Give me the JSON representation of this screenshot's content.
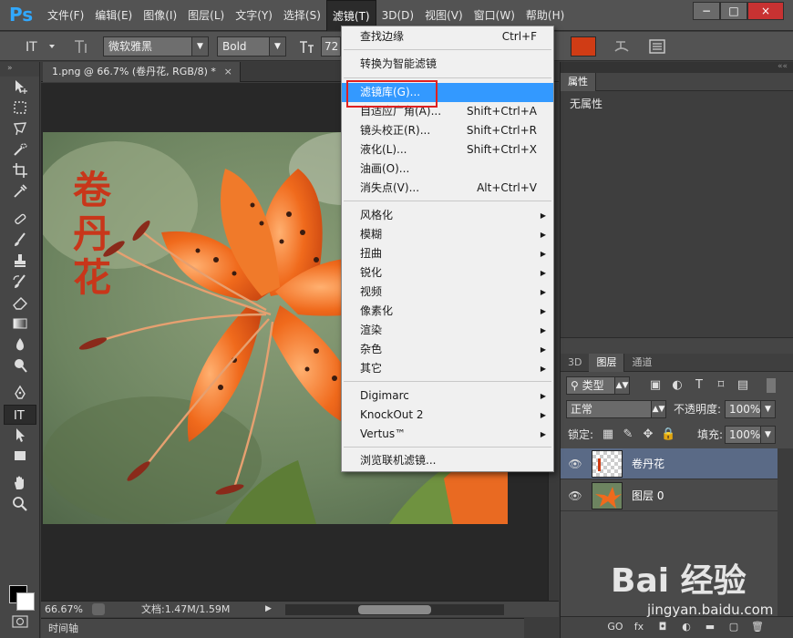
{
  "app": {
    "logo": "Ps"
  },
  "menubar": {
    "items": [
      "文件(F)",
      "编辑(E)",
      "图像(I)",
      "图层(L)",
      "文字(Y)",
      "选择(S)",
      "滤镜(T)",
      "3D(D)",
      "视图(V)",
      "窗口(W)",
      "帮助(H)"
    ],
    "active_index": 6,
    "window_controls": [
      "−",
      "□",
      "×"
    ]
  },
  "options_bar": {
    "font_family": "微软雅黑",
    "font_style": "Bold",
    "font_size": "72",
    "text_color": "#d03c15"
  },
  "document": {
    "tab_title": "1.png @ 66.7% (卷丹花, RGB/8) *",
    "tab_close": "×",
    "canvas_text": "卷丹花",
    "zoom": "66.67%",
    "doc_size": "文档:1.47M/1.59M"
  },
  "timeline": {
    "label": "时间轴"
  },
  "properties_panel": {
    "tab": "属性",
    "content": "无属性"
  },
  "layers_panel": {
    "tabs": [
      "3D",
      "图层",
      "通道"
    ],
    "active_tab": 1,
    "filter_kind": "类型",
    "blend_mode": "正常",
    "opacity_label": "不透明度:",
    "opacity_value": "100%",
    "lock_label": "锁定:",
    "fill_label": "填充:",
    "fill_value": "100%",
    "layers": [
      {
        "name": "卷丹花",
        "selected": true
      },
      {
        "name": "图层 0",
        "selected": false
      }
    ],
    "bottom_icons": [
      "GO",
      "fx",
      "◘",
      "◐",
      "▬",
      "▢",
      "🗑"
    ]
  },
  "filter_menu": {
    "items": [
      {
        "label": "查找边缘",
        "shortcut": "Ctrl+F",
        "submenu": false
      },
      {
        "label": "转换为智能滤镜",
        "shortcut": "",
        "submenu": false
      },
      {
        "label": "滤镜库(G)...",
        "shortcut": "",
        "submenu": false,
        "highlighted": true
      },
      {
        "label": "自适应广角(A)...",
        "shortcut": "Shift+Ctrl+A",
        "submenu": false
      },
      {
        "label": "镜头校正(R)...",
        "shortcut": "Shift+Ctrl+R",
        "submenu": false
      },
      {
        "label": "液化(L)...",
        "shortcut": "Shift+Ctrl+X",
        "submenu": false
      },
      {
        "label": "油画(O)...",
        "shortcut": "",
        "submenu": false
      },
      {
        "label": "消失点(V)...",
        "shortcut": "Alt+Ctrl+V",
        "submenu": false
      },
      {
        "label": "风格化",
        "shortcut": "",
        "submenu": true
      },
      {
        "label": "模糊",
        "shortcut": "",
        "submenu": true
      },
      {
        "label": "扭曲",
        "shortcut": "",
        "submenu": true
      },
      {
        "label": "锐化",
        "shortcut": "",
        "submenu": true
      },
      {
        "label": "视频",
        "shortcut": "",
        "submenu": true
      },
      {
        "label": "像素化",
        "shortcut": "",
        "submenu": true
      },
      {
        "label": "渲染",
        "shortcut": "",
        "submenu": true
      },
      {
        "label": "杂色",
        "shortcut": "",
        "submenu": true
      },
      {
        "label": "其它",
        "shortcut": "",
        "submenu": true
      },
      {
        "label": "Digimarc",
        "shortcut": "",
        "submenu": true
      },
      {
        "label": "KnockOut 2",
        "shortcut": "",
        "submenu": true
      },
      {
        "label": "Vertus™",
        "shortcut": "",
        "submenu": true
      },
      {
        "label": "浏览联机滤镜...",
        "shortcut": "",
        "submenu": false
      }
    ]
  },
  "watermark": {
    "brand": "Bai 经验",
    "url": "jingyan.baidu.com"
  },
  "colors": {
    "accent_blue": "#3399ff",
    "highlight_red": "#e02020",
    "brand_red": "#c8361a"
  }
}
